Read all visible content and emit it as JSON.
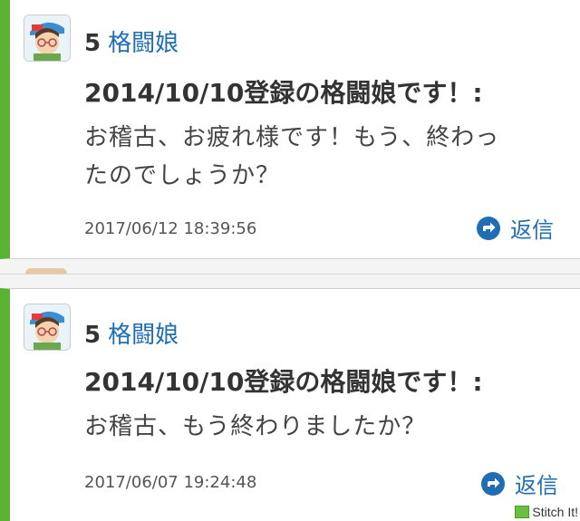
{
  "posts": [
    {
      "number": "5",
      "username": "格闘娘",
      "title": "2014/10/10登録の格闘娘です！:",
      "message_lines": [
        "お稽古、お疲れ様です！もう、終わっ",
        "たのでしょうか？"
      ],
      "timestamp": "2017/06/12 18:39:56",
      "reply_label": "返信"
    },
    {
      "number": "5",
      "username": "格闘娘",
      "title": "2014/10/10登録の格闘娘です！:",
      "message_lines": [
        "お稽古、もう終わりましたか？"
      ],
      "timestamp": "2017/06/07 19:24:48",
      "reply_label": "返信"
    }
  ],
  "watermark": "Stitch It!",
  "colors": {
    "accent_bar": "#5ab431",
    "link": "#1f6eb4"
  },
  "icons": [
    "avatar-icon",
    "reply-arrow-icon",
    "stitch-icon"
  ]
}
